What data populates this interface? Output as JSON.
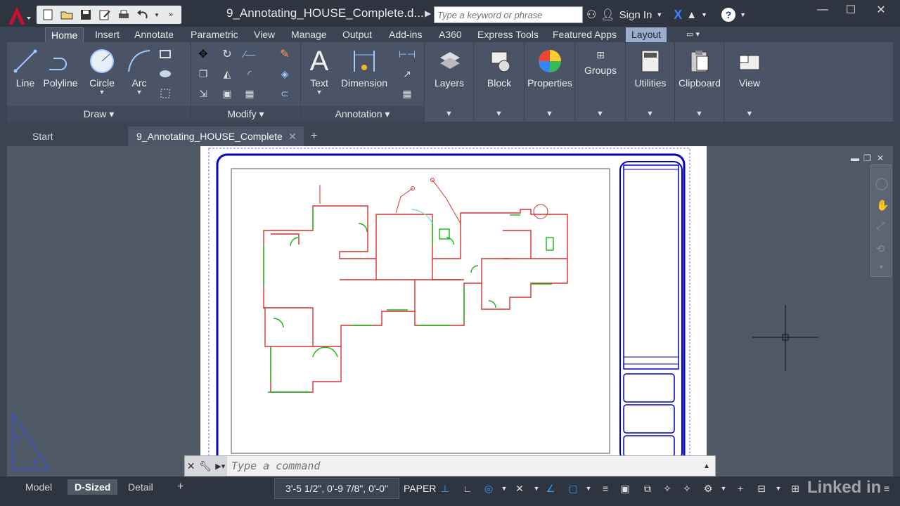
{
  "title_bar": {
    "doc_title": "9_Annotating_HOUSE_Complete.d...",
    "search_placeholder": "Type a keyword or phrase",
    "sign_in": "Sign In"
  },
  "ribbon_tabs": [
    "Home",
    "Insert",
    "Annotate",
    "Parametric",
    "View",
    "Manage",
    "Output",
    "Add-ins",
    "A360",
    "Express Tools",
    "Featured Apps",
    "Layout"
  ],
  "ribbon": {
    "draw": {
      "title": "Draw",
      "line": "Line",
      "polyline": "Polyline",
      "circle": "Circle",
      "arc": "Arc"
    },
    "modify": {
      "title": "Modify"
    },
    "annotation": {
      "title": "Annotation",
      "text": "Text",
      "dimension": "Dimension"
    },
    "layers": "Layers",
    "block": "Block",
    "properties": "Properties",
    "groups": "Groups",
    "utilities": "Utilities",
    "clipboard": "Clipboard",
    "view": "View"
  },
  "file_tabs": {
    "start": "Start",
    "current": "9_Annotating_HOUSE_Complete"
  },
  "command_line": {
    "placeholder": "Type a command"
  },
  "layout_tabs": [
    "Model",
    "D-Sized",
    "Detail"
  ],
  "status": {
    "coords": "3'-5 1/2\", 0'-9 7/8\", 0'-0\"",
    "space": "PAPER",
    "watermark": "Linked in"
  },
  "colors": {
    "title_block": "#0000c8",
    "walls": "#d2322d",
    "doors": "#18b418"
  }
}
